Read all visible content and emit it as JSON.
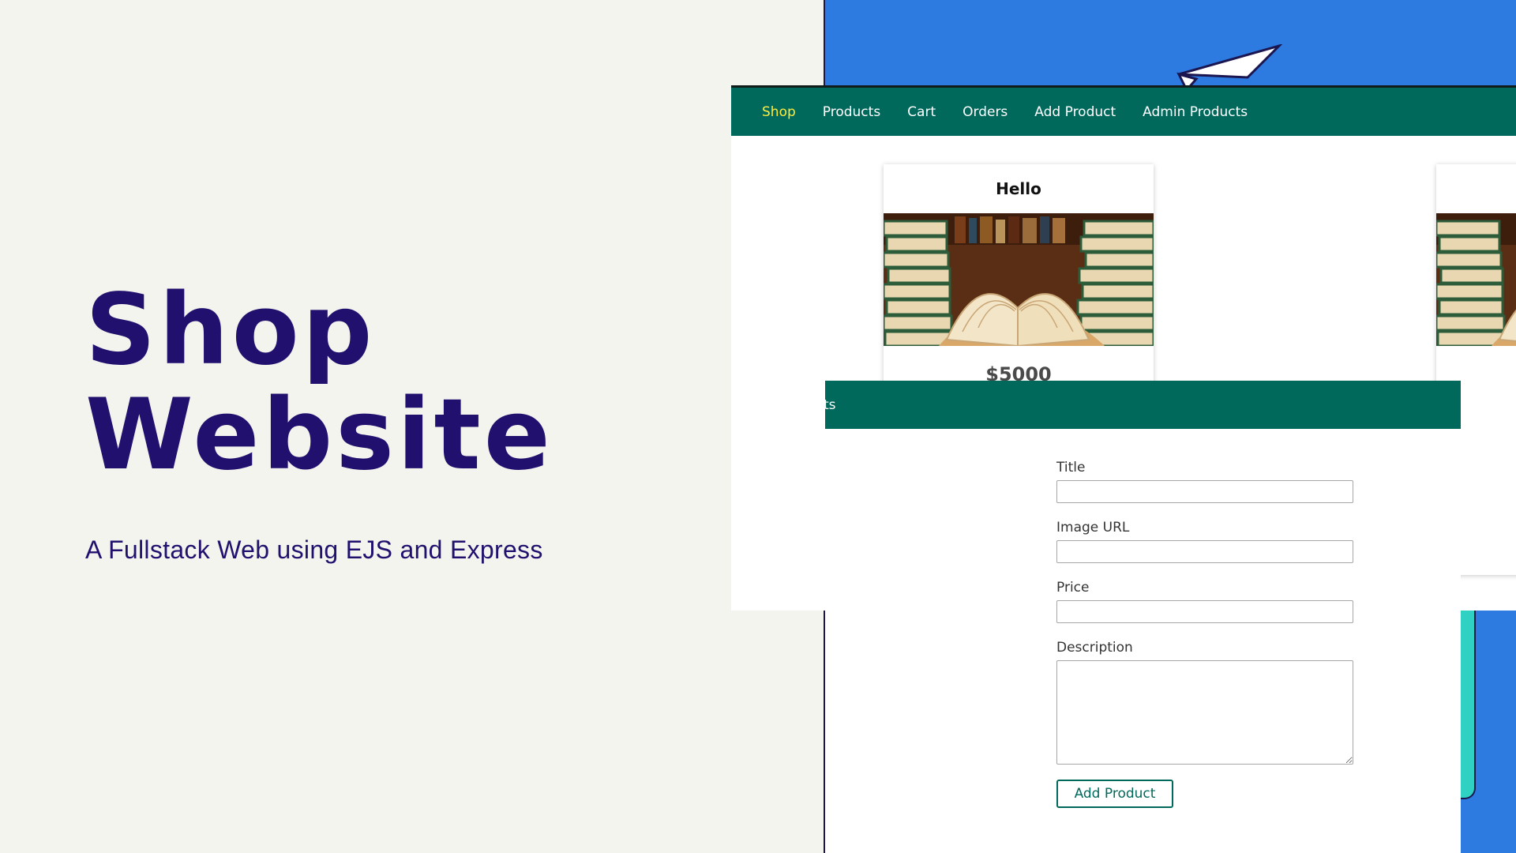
{
  "hero": {
    "title_line1": "Shop",
    "title_line2": "Website",
    "subtitle": "A Fullstack Web using EJS and Express"
  },
  "colors": {
    "page_background": "#f4f4ef",
    "title_color": "#22106e",
    "decor_blue": "#2d7be0",
    "decor_teal": "#2fd1c2",
    "shop_nav": "#00695c",
    "nav_active": "#ffeb3b"
  },
  "shop_screenshot": {
    "nav": {
      "items": [
        {
          "label": "Shop",
          "active": true
        },
        {
          "label": "Products",
          "active": false
        },
        {
          "label": "Cart",
          "active": false
        },
        {
          "label": "Orders",
          "active": false
        },
        {
          "label": "Add Product",
          "active": false
        },
        {
          "label": "Admin Products",
          "active": false
        }
      ]
    },
    "products": [
      {
        "title": "Hello",
        "image": "open-book-stack-image",
        "price": "$5000"
      },
      {
        "title": "",
        "image": "open-book-stack-image",
        "price": ""
      }
    ]
  },
  "form_screenshot": {
    "nav_fragment": "ts",
    "fields": {
      "title_label": "Title",
      "title_value": "",
      "image_url_label": "Image URL",
      "image_url_value": "",
      "price_label": "Price",
      "price_value": "",
      "description_label": "Description",
      "description_value": ""
    },
    "submit_label": "Add Product"
  },
  "decor": {
    "plane_icon": "paper-plane-icon"
  }
}
